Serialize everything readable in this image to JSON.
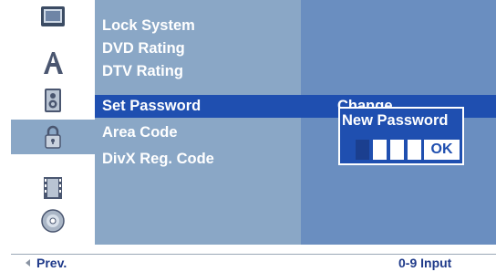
{
  "menu": {
    "items": [
      {
        "label": "Lock System"
      },
      {
        "label": "DVD Rating"
      },
      {
        "label": "DTV Rating"
      },
      {
        "label": "Set Password",
        "selected": true
      },
      {
        "label": "Area Code"
      },
      {
        "label": "DivX Reg. Code"
      }
    ]
  },
  "side_icons": [
    "tv-icon",
    "language-icon",
    "speaker-icon",
    "lock-icon",
    "film-icon",
    "disc-icon"
  ],
  "active_icon": "lock-icon",
  "submenu": {
    "option_label": "Change",
    "dialog_title": "New Password",
    "digits_entered": 0,
    "digit_slots": 4,
    "ok_label": "OK"
  },
  "footer": {
    "prev_label": "Prev.",
    "input_hint": "0-9  Input"
  },
  "colors": {
    "menu_bg": "#8aa7c6",
    "panel_bg": "#6a8ec0",
    "selection": "#1f4fb0",
    "text": "#ffffff",
    "footer_text": "#1f3a8a"
  }
}
